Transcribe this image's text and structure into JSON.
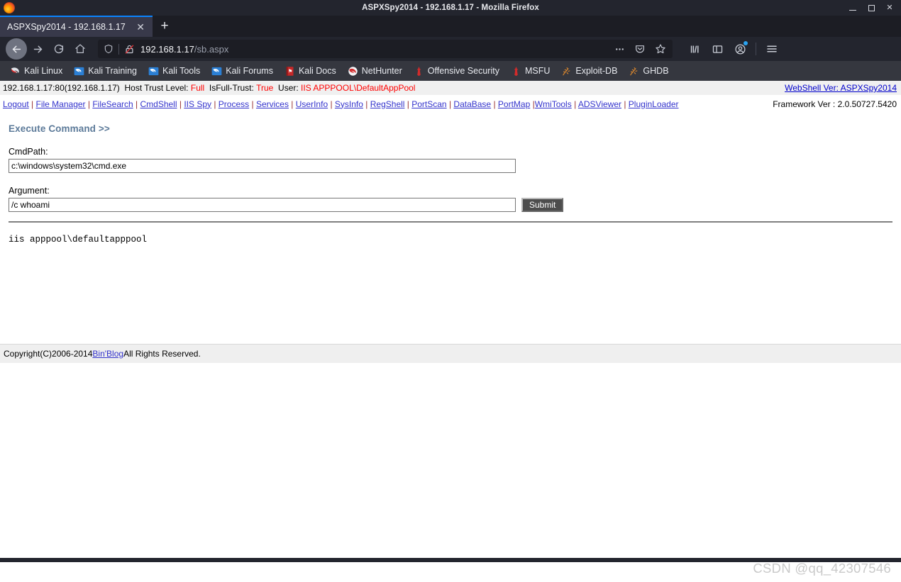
{
  "window": {
    "title": "ASPXSpy2014 - 192.168.1.17 - Mozilla Firefox",
    "minimize_label": "—",
    "maximize_label": "□",
    "close_label": "✕",
    "logo_name": "firefox-logo"
  },
  "tabs": {
    "active_tab_title": "ASPXSpy2014 - 192.168.1.17",
    "close_label": "✕",
    "new_tab_label": "+"
  },
  "navigation": {
    "back_label": "←",
    "forward_label": "→",
    "reload_label": "⟳",
    "home_label": "⌂"
  },
  "urlbar": {
    "host": "192.168.1.17",
    "path": "/sb.aspx",
    "page_actions_label": "…",
    "pocket_label": "save-to-pocket",
    "bookmark_label": "bookmark-star"
  },
  "toolbar_right": {
    "library_label": "library",
    "sidebar_label": "sidebar",
    "account_label": "account",
    "menu_label": "☰"
  },
  "bookmarks": [
    {
      "label": "Kali Linux",
      "icon": "kali-dragon-icon"
    },
    {
      "label": "Kali Training",
      "icon": "kali-dragon-blue-icon"
    },
    {
      "label": "Kali Tools",
      "icon": "kali-dragon-blue-icon"
    },
    {
      "label": "Kali Forums",
      "icon": "kali-dragon-blue-icon"
    },
    {
      "label": "Kali Docs",
      "icon": "kali-docs-book-icon"
    },
    {
      "label": "NetHunter",
      "icon": "nethunter-icon"
    },
    {
      "label": "Offensive Security",
      "icon": "offsec-icon"
    },
    {
      "label": "MSFU",
      "icon": "offsec-icon"
    },
    {
      "label": "Exploit-DB",
      "icon": "exploit-db-icon"
    },
    {
      "label": "GHDB",
      "icon": "ghdb-icon"
    }
  ],
  "shell": {
    "info": {
      "server": "192.168.1.17:80(192.168.1.17)",
      "trust_level_label": "Host Trust Level:",
      "trust_level_value": "Full",
      "isfulltrust_label": "IsFull-Trust:",
      "isfulltrust_value": "True",
      "user_label": "User:",
      "user_value": "IIS APPPOOL\\DefaultAppPool",
      "version_link": "WebShell Ver: ASPXSpy2014"
    },
    "menu": [
      "Logout",
      "File Manager",
      "FileSearch",
      "CmdShell",
      "IIS Spy",
      "Process",
      "Services",
      "UserInfo",
      "SysInfo",
      "RegShell",
      "PortScan",
      "DataBase",
      "PortMap",
      "WmiTools",
      "ADSViewer",
      "PluginLoader"
    ],
    "framework_version": "Framework Ver : 2.0.50727.5420",
    "section_title": "Execute Command >>",
    "cmdpath_label": "CmdPath:",
    "cmdpath_value": "c:\\windows\\system32\\cmd.exe",
    "argument_label": "Argument:",
    "argument_value": "/c whoami",
    "submit_label": "Submit",
    "output": "iis apppool\\defaultapppool",
    "footer_prefix": "Copyright(C)2006-2014 ",
    "footer_link": "Bin'Blog",
    "footer_suffix": " All Rights Reserved."
  },
  "watermark": "CSDN @qq_42307546",
  "colors": {
    "chrome_bg": "#23252e",
    "tab_active": "#38394a",
    "tab_accent": "#0a84ff",
    "bookmark_bar": "#35373f",
    "link_blue": "#3333cc",
    "value_red": "#ff0000",
    "section_blue": "#5c7a99",
    "footer_bg": "#efefef"
  }
}
